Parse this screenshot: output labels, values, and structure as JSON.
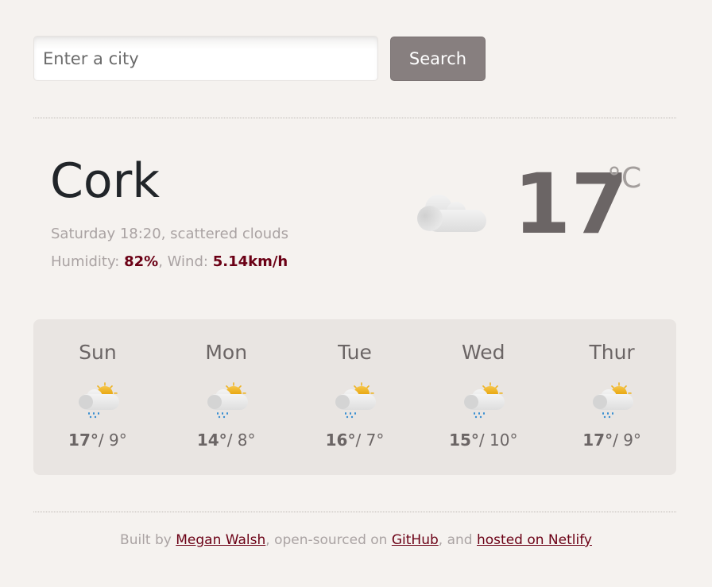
{
  "search": {
    "placeholder": "Enter a city",
    "value": "",
    "button_label": "Search"
  },
  "current": {
    "city": "Cork",
    "day_time": "Saturday 18:20",
    "description": "scattered clouds",
    "humidity_label": "Humidity:",
    "humidity_value": "82%",
    "wind_label": "Wind:",
    "wind_value": "5.14km/h",
    "temperature": "17",
    "unit": "°C",
    "icon": "cloud-icon"
  },
  "forecast": [
    {
      "day": "Sun",
      "high": "17°",
      "low": "9°",
      "icon": "partly-cloudy-rain-icon"
    },
    {
      "day": "Mon",
      "high": "14°",
      "low": "8°",
      "icon": "partly-cloudy-rain-icon"
    },
    {
      "day": "Tue",
      "high": "16°",
      "low": "7°",
      "icon": "partly-cloudy-rain-icon"
    },
    {
      "day": "Wed",
      "high": "15°",
      "low": "10°",
      "icon": "partly-cloudy-rain-icon"
    },
    {
      "day": "Thur",
      "high": "17°",
      "low": "9°",
      "icon": "partly-cloudy-rain-icon"
    }
  ],
  "footer": {
    "built_by": "Built by",
    "author": "Megan Walsh",
    "open_sourced": ", open-sourced on",
    "github": "GitHub",
    "and": ", and",
    "netlify": "hosted on Netlify"
  },
  "colors": {
    "accent": "#6b0015",
    "button": "#877f7f",
    "temp_text": "#6b6565",
    "muted_text": "#aaa3a3",
    "forecast_bg": "#e9e5e2"
  }
}
